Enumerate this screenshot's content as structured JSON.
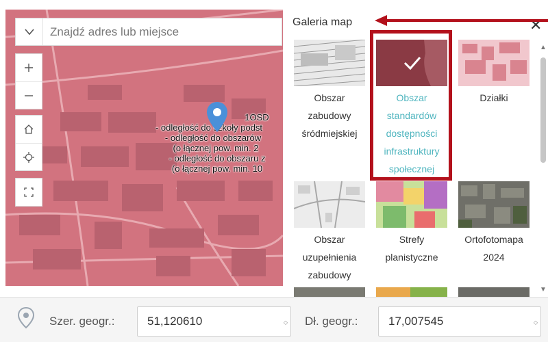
{
  "map": {
    "search_placeholder": "Znajdź adres lub miejsce",
    "popup": {
      "lines": [
        "1OSD",
        "- odległość do szkoły podst",
        "- odległość do obszarów",
        "(o łącznej pow. min. 2",
        "- odległość do obszaru z",
        "(o łącznej pow. min. 10"
      ]
    },
    "colors": {
      "overlay": "#d2737f",
      "marker": "#4a90d9"
    }
  },
  "gallery": {
    "title": "Galeria map",
    "items": [
      {
        "label": "Obszar zabudowy śródmiejskiej",
        "selected": false,
        "thumb": "gray-lines"
      },
      {
        "label": "Obszar standardów dostępności infrastruktury społecznej",
        "selected": true,
        "thumb": "maroon-selected"
      },
      {
        "label": "Działki",
        "selected": false,
        "thumb": "pink-parcels"
      },
      {
        "label": "Obszar uzupełnienia zabudowy",
        "selected": false,
        "thumb": "gray-map"
      },
      {
        "label": "Strefy planistyczne",
        "selected": false,
        "thumb": "colored-zones"
      },
      {
        "label": "Ortofotomapa 2024",
        "selected": false,
        "thumb": "orthophoto"
      }
    ],
    "colors": {
      "highlight": "#b3111c",
      "selected_text": "#4fb5bf"
    }
  },
  "coordinates": {
    "lat_label": "Szer. geogr.:",
    "lat_value": "51,120610",
    "lon_label": "Dł. geogr.:",
    "lon_value": "17,007545"
  }
}
